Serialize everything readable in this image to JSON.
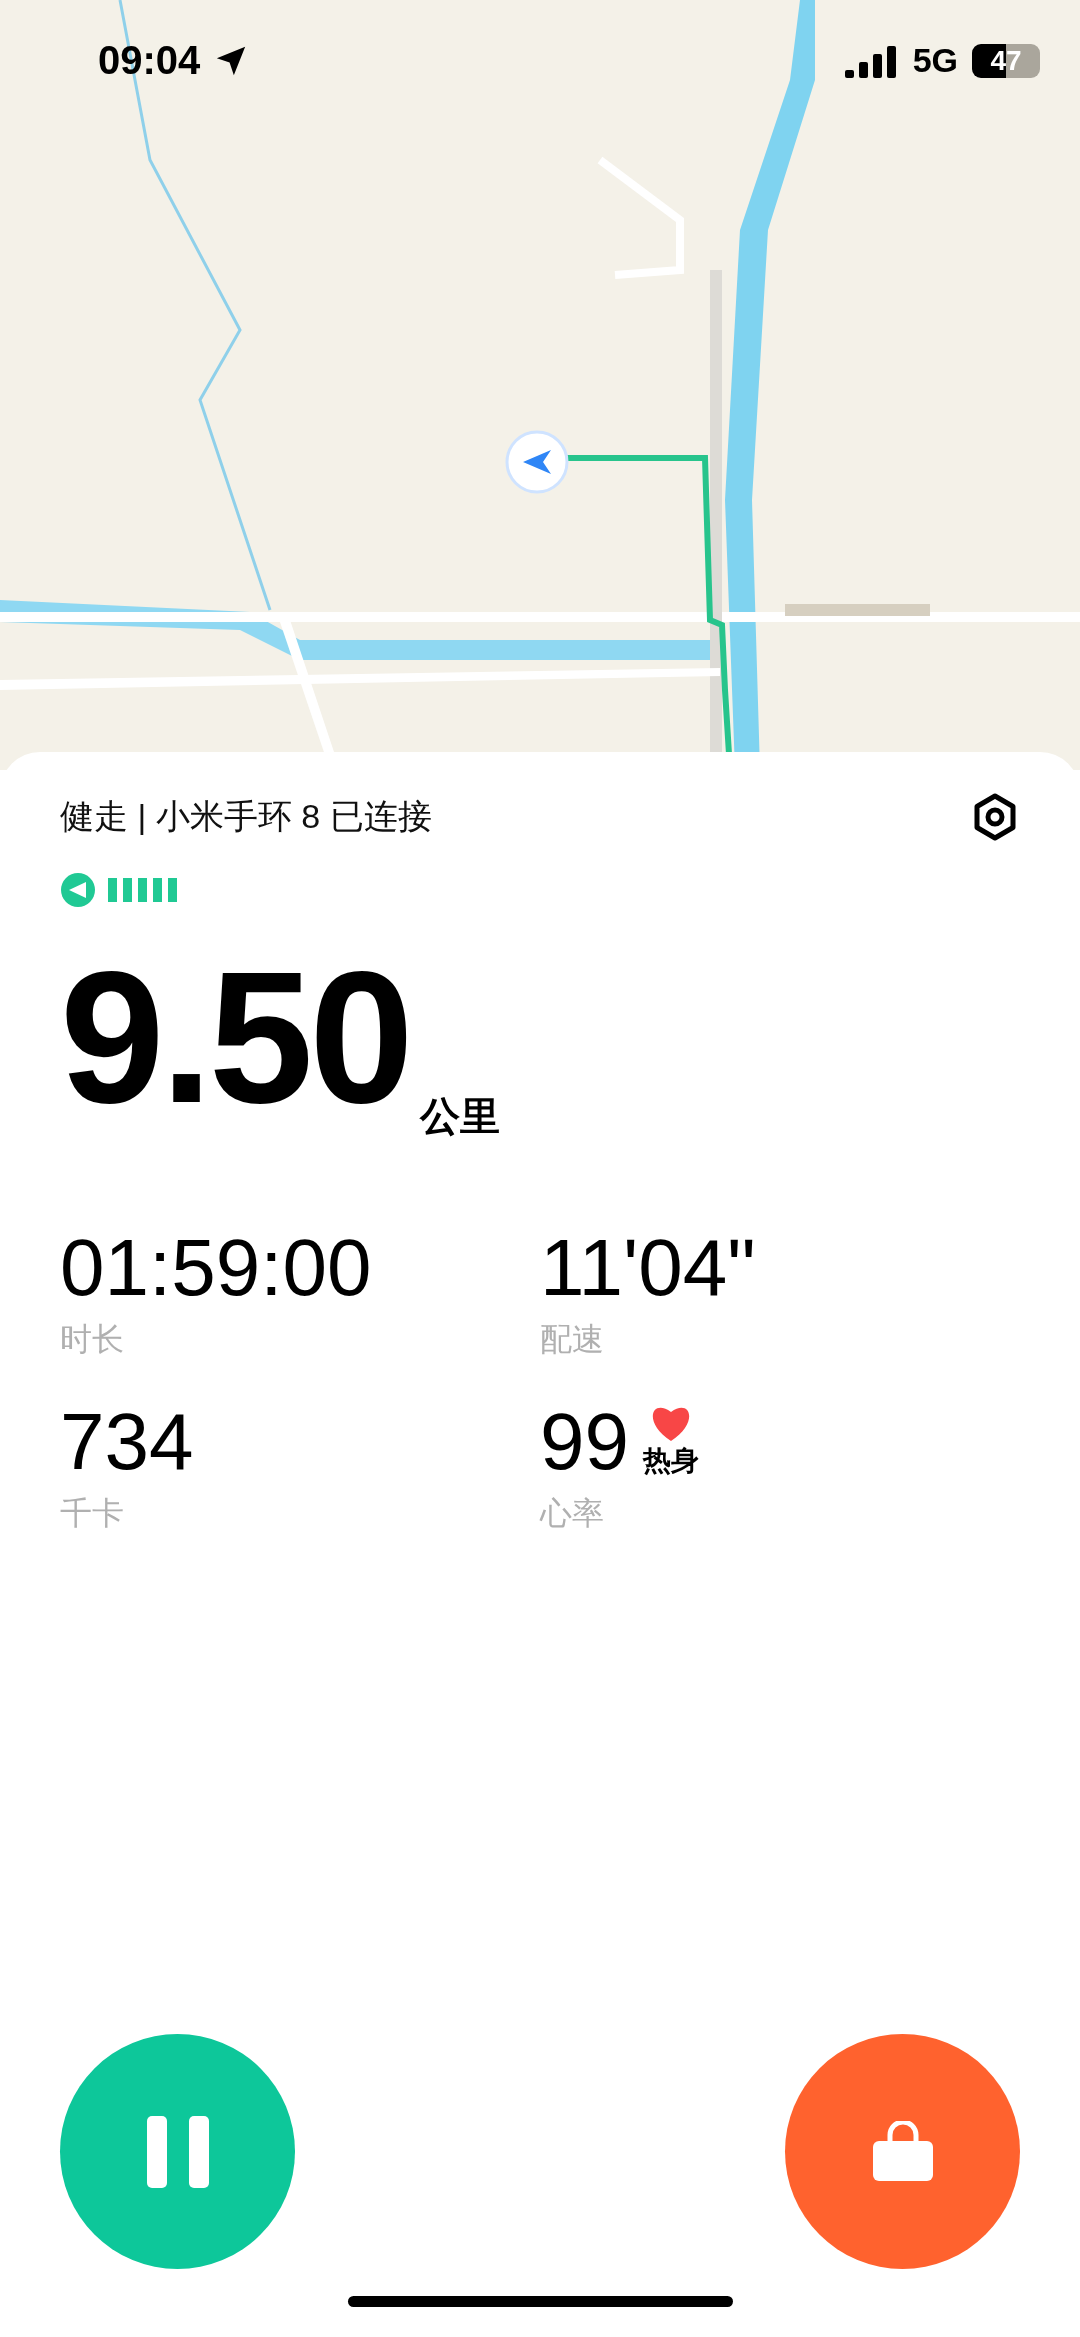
{
  "status_bar": {
    "time": "09:04",
    "network": "5G",
    "battery": "47"
  },
  "workout": {
    "title": "健走 | 小米手环 8 已连接",
    "distance": "9.50",
    "distance_unit": "公里",
    "stats": [
      {
        "value": "01:59:00",
        "label": "时长"
      },
      {
        "value": "11'04\"",
        "label": "配速"
      },
      {
        "value": "734",
        "label": "千卡"
      },
      {
        "value": "99",
        "label": "心率",
        "zone": "热身"
      }
    ]
  },
  "controls": {
    "paused": false
  }
}
